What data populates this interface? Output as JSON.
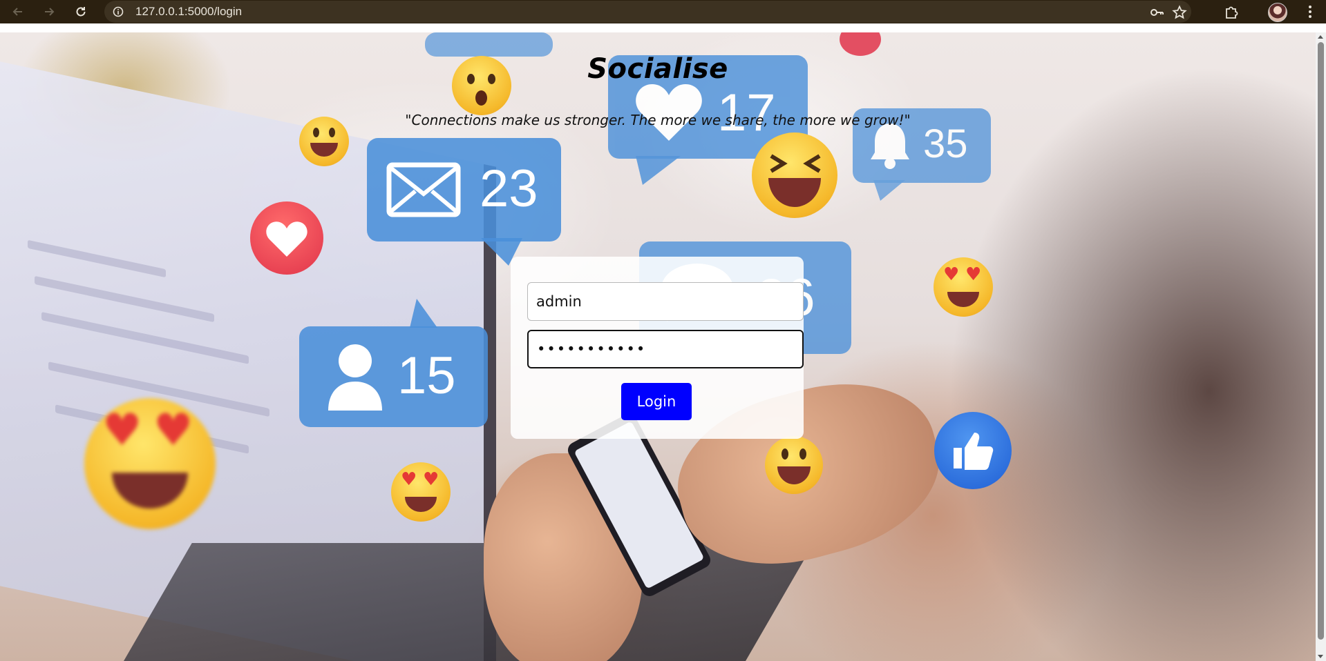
{
  "browser": {
    "url": "127.0.0.1:5000/login",
    "icons": {
      "back": "arrow-left-icon",
      "forward": "arrow-right-icon",
      "reload": "reload-icon",
      "site_info": "info-icon",
      "passwords": "key-icon",
      "bookmark": "star-icon",
      "extensions": "puzzle-icon",
      "profile": "avatar",
      "menu": "kebab-menu-icon"
    },
    "colors": {
      "toolbar": "#2b2010",
      "omnibox": "#3d3221"
    }
  },
  "page": {
    "title": "Socialise",
    "tagline": "\"Connections make us stronger. The more we share, the more we grow!\"",
    "background_bubbles": [
      {
        "icon": "envelope-icon",
        "count": "23"
      },
      {
        "icon": "user-icon",
        "count": "15"
      },
      {
        "icon": "heart-icon",
        "count": "17"
      },
      {
        "icon": "bell-icon",
        "count": "35"
      },
      {
        "icon": "comment-icon",
        "count": "26"
      }
    ]
  },
  "login_form": {
    "username_value": "admin",
    "password_value": "•••••••••••",
    "login_button": "Login",
    "colors": {
      "button": "#0000ff",
      "button_text": "#ffffff"
    }
  }
}
